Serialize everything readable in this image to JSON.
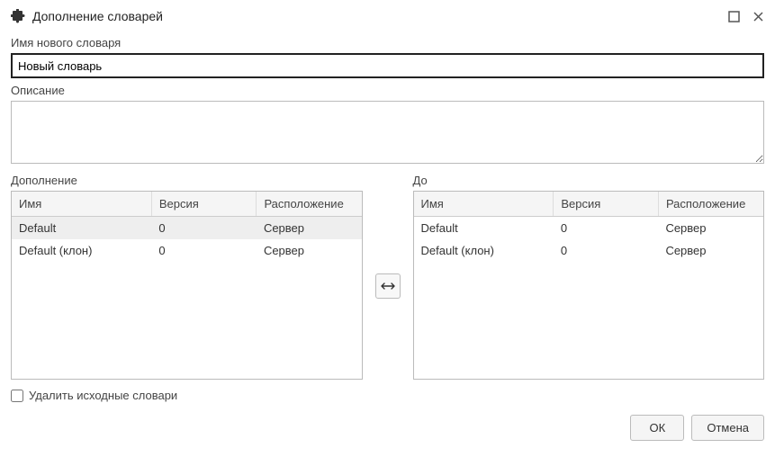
{
  "window": {
    "title": "Дополнение словарей"
  },
  "fields": {
    "name_label": "Имя нового словаря",
    "name_value": "Новый словарь",
    "description_label": "Описание",
    "description_value": ""
  },
  "left": {
    "title": "Дополнение",
    "cols": {
      "name": "Имя",
      "version": "Версия",
      "location": "Расположение"
    },
    "rows": [
      {
        "name": "Default",
        "version": "0",
        "location": "Сервер",
        "selected": true
      },
      {
        "name": "Default (клон)",
        "version": "0",
        "location": "Сервер",
        "selected": false
      }
    ]
  },
  "right": {
    "title": "До",
    "cols": {
      "name": "Имя",
      "version": "Версия",
      "location": "Расположение"
    },
    "rows": [
      {
        "name": "Default",
        "version": "0",
        "location": "Сервер",
        "selected": false
      },
      {
        "name": "Default (клон)",
        "version": "0",
        "location": "Сервер",
        "selected": false
      }
    ]
  },
  "checkbox": {
    "label": "Удалить исходные словари",
    "checked": false
  },
  "buttons": {
    "ok": "ОК",
    "cancel": "Отмена"
  }
}
